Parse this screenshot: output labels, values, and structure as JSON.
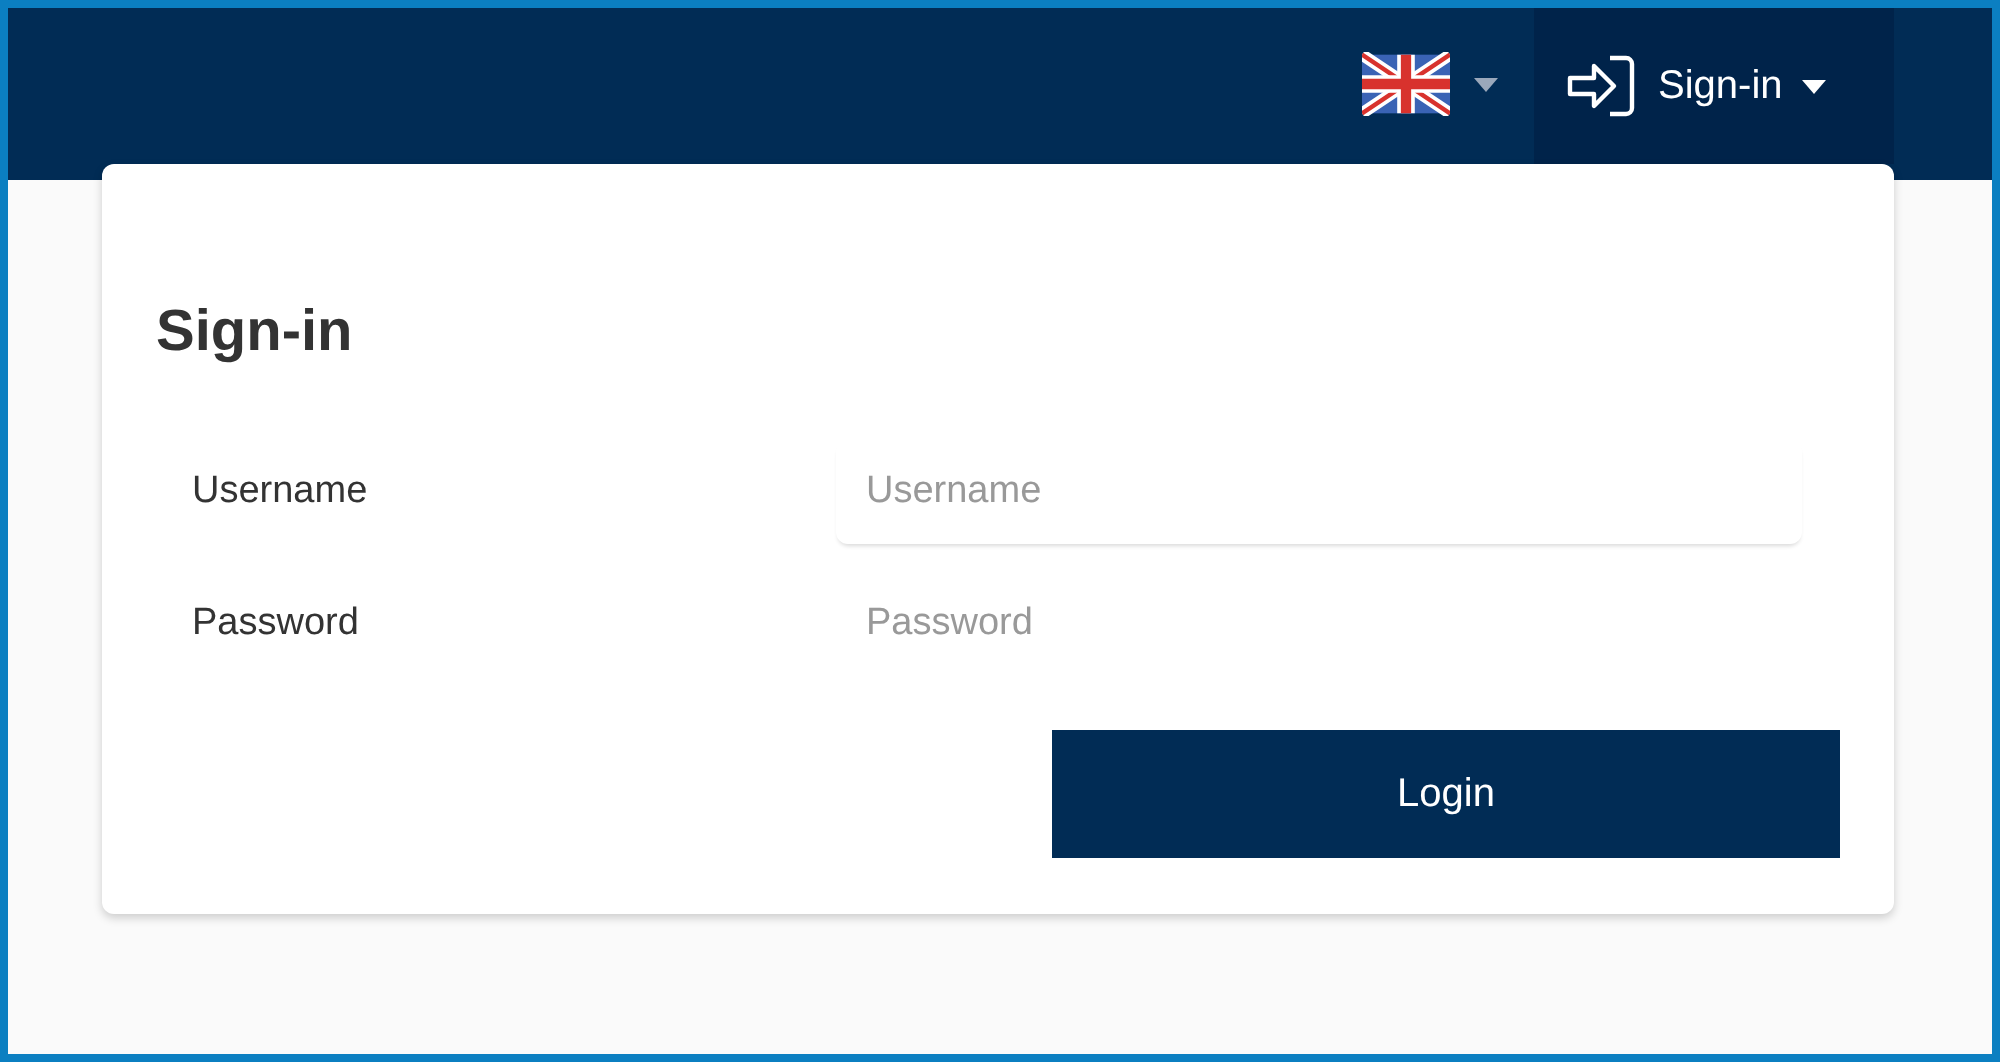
{
  "header": {
    "account_menu": {
      "label": "Sign-in"
    }
  },
  "form": {
    "title": "Sign-in",
    "fields": [
      {
        "label": "Username",
        "placeholder": "Username",
        "kind": "text"
      },
      {
        "label": "Password",
        "placeholder": "Password",
        "kind": "password"
      }
    ],
    "submit": {
      "label": "Login"
    }
  }
}
